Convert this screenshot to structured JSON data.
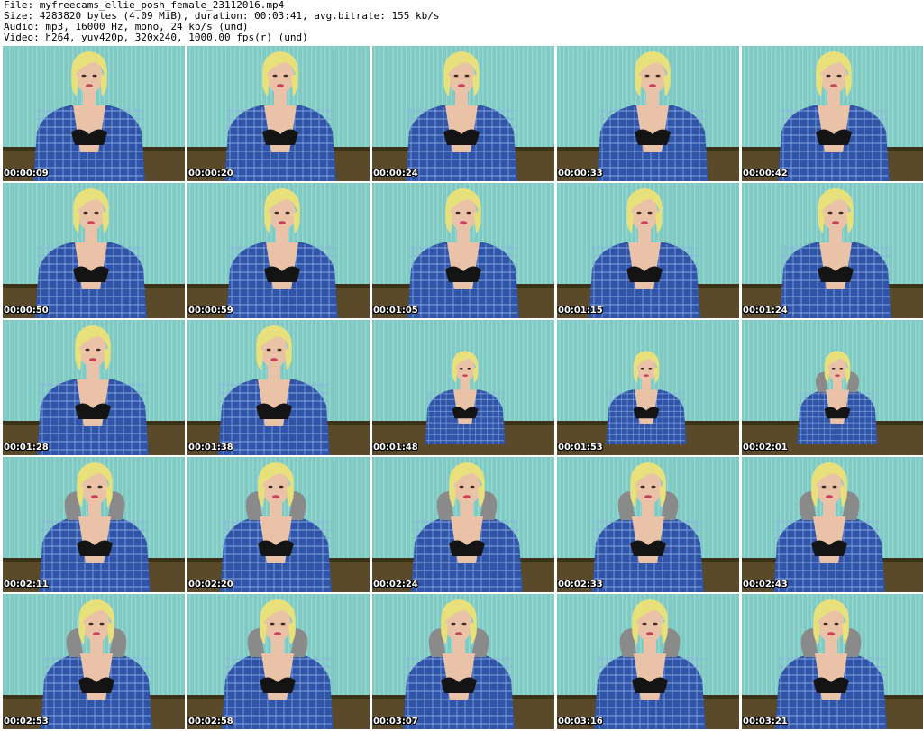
{
  "header": {
    "file_line": "File: myfreecams_ellie_posh_female_23112016.mp4",
    "size_line": "Size: 4283820 bytes (4.09 MiB), duration: 00:03:41, avg.bitrate: 155 kb/s",
    "audio_line": "Audio: mp3, 16000 Hz, mono, 24 kb/s (und)",
    "video_line": "Video: h264, yuv420p, 320x240, 1000.00 fps(r) (und)"
  },
  "colors": {
    "wall": "#7fcbc4",
    "wall_stripe": "#a9e0d9",
    "shirt": "#2f54a8",
    "shirt_check": "#8fb0e6",
    "hair": "#e8e07a",
    "skin": "#e9c2a8",
    "sofa": "#5b4a2a",
    "bra": "#141414",
    "hood": "#8a8a8a"
  },
  "thumbnails": [
    {
      "time": "00:00:09"
    },
    {
      "time": "00:00:20"
    },
    {
      "time": "00:00:24"
    },
    {
      "time": "00:00:33"
    },
    {
      "time": "00:00:42"
    },
    {
      "time": "00:00:50"
    },
    {
      "time": "00:00:59"
    },
    {
      "time": "00:01:05"
    },
    {
      "time": "00:01:15"
    },
    {
      "time": "00:01:24"
    },
    {
      "time": "00:01:28"
    },
    {
      "time": "00:01:38"
    },
    {
      "time": "00:01:48"
    },
    {
      "time": "00:01:53"
    },
    {
      "time": "00:02:01"
    },
    {
      "time": "00:02:11"
    },
    {
      "time": "00:02:20"
    },
    {
      "time": "00:02:24"
    },
    {
      "time": "00:02:33"
    },
    {
      "time": "00:02:43"
    },
    {
      "time": "00:02:53"
    },
    {
      "time": "00:02:58"
    },
    {
      "time": "00:03:07"
    },
    {
      "time": "00:03:16"
    },
    {
      "time": "00:03:21"
    }
  ]
}
